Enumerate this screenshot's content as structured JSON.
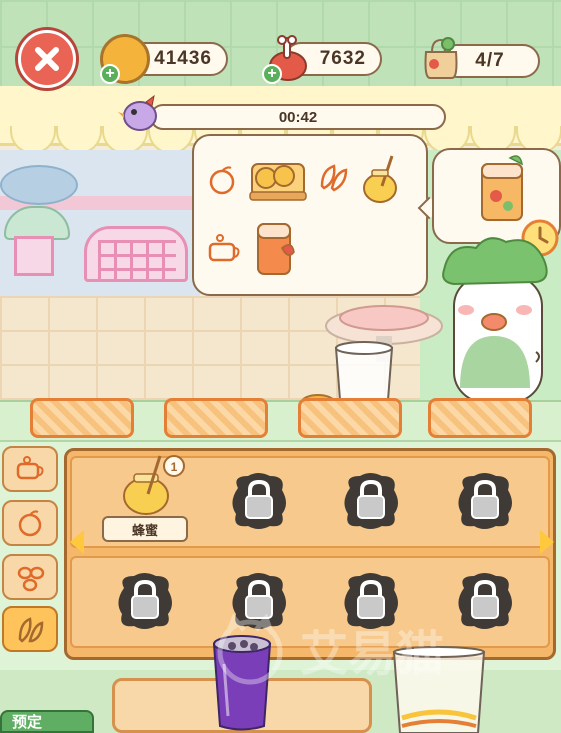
{
  "hud": {
    "close_icon": "close-x-icon",
    "coins": "41436",
    "meat": "7632",
    "orders": "4/7",
    "plus_symbol": "+"
  },
  "timer": {
    "time": "00:42"
  },
  "recipe": {
    "ingredients": [
      "orange-icon",
      "cake-slices-icon",
      "leaf-icon",
      "honey-jar-icon",
      "coffee-cup-icon",
      "juice-cup-icon"
    ]
  },
  "order": {
    "item": "fruit-drink-icon",
    "clock": "clock-icon"
  },
  "station": {
    "tabs": [
      "coffee-cup-icon",
      "orange-icon",
      "peanut-icon",
      "leaf-icon"
    ],
    "active_tab": 3,
    "unlocked_item": {
      "icon": "honey-jar-icon",
      "label": "蜂蜜",
      "level": "1"
    }
  },
  "bottom": {
    "button_label": "预定"
  },
  "watermark": {
    "text": "艾易猫"
  },
  "colors": {
    "accent": "#f5b86a",
    "close": "#e96454",
    "green": "#5fae63",
    "text": "#4a3626"
  }
}
